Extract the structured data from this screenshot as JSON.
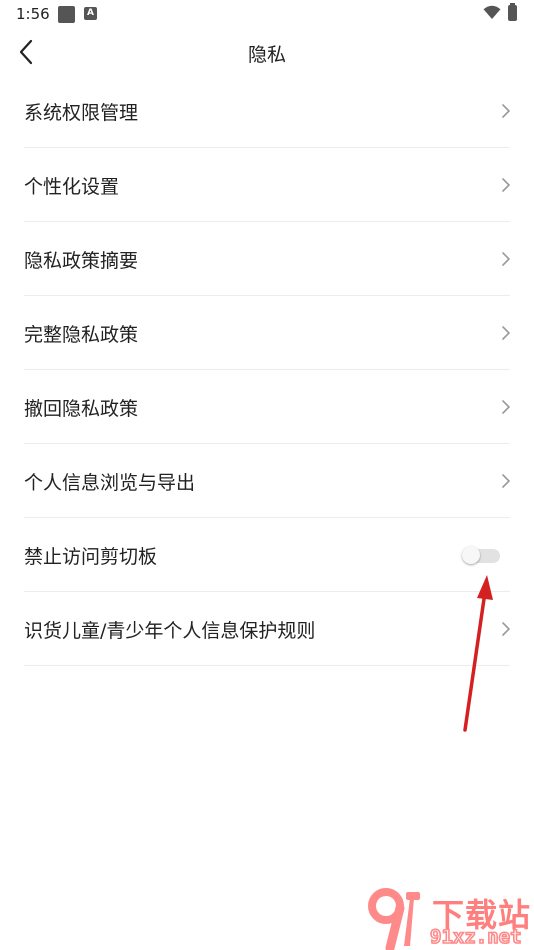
{
  "status_bar": {
    "time": "1:56",
    "a_icon_letter": "A"
  },
  "header": {
    "title": "隐私"
  },
  "list": {
    "items": [
      {
        "label": "系统权限管理",
        "control": "chevron"
      },
      {
        "label": "个性化设置",
        "control": "chevron"
      },
      {
        "label": "隐私政策摘要",
        "control": "chevron"
      },
      {
        "label": "完整隐私政策",
        "control": "chevron"
      },
      {
        "label": "撤回隐私政策",
        "control": "chevron"
      },
      {
        "label": "个人信息浏览与导出",
        "control": "chevron"
      },
      {
        "label": "禁止访问剪切板",
        "control": "toggle",
        "toggle_on": false
      },
      {
        "label": "识货儿童/青少年个人信息保护规则",
        "control": "chevron"
      }
    ]
  },
  "annotation": {
    "color": "#d42020"
  },
  "watermark": {
    "brand": "下载站",
    "url": "91xz.net",
    "color": "#ff7f7f"
  }
}
